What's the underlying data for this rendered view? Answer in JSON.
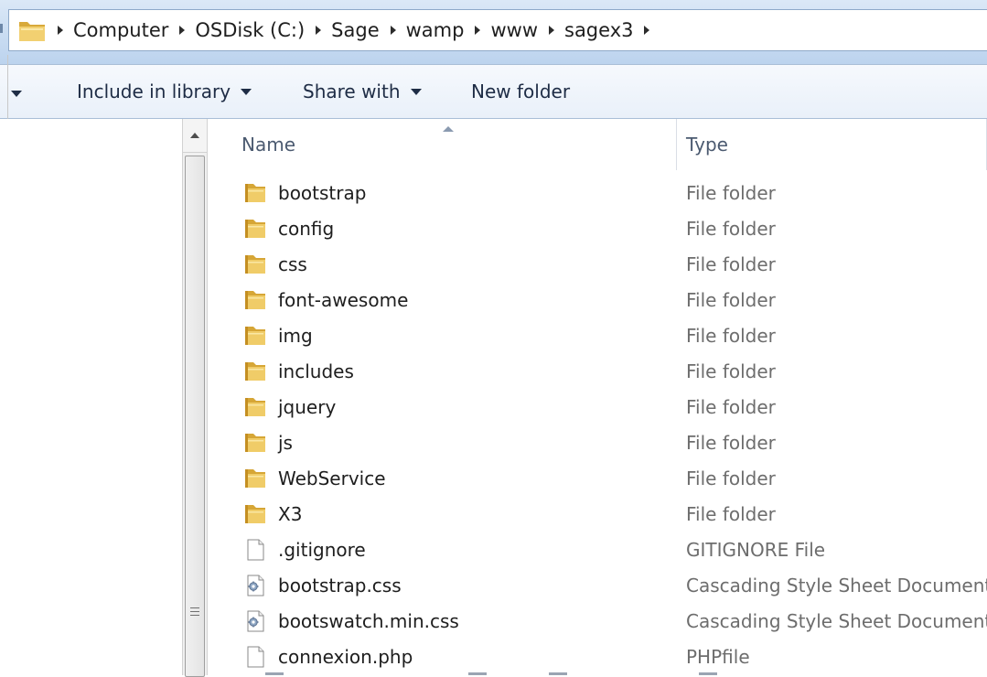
{
  "address_bar": {
    "breadcrumbs": [
      "Computer",
      "OSDisk (C:)",
      "Sage",
      "wamp",
      "www",
      "sagex3"
    ]
  },
  "command_bar": {
    "include_in_library": "Include in library",
    "share_with": "Share with",
    "new_folder": "New folder"
  },
  "columns": {
    "name": "Name",
    "type": "Type"
  },
  "files": [
    {
      "name": "bootstrap",
      "type": "File folder",
      "icon": "folder-icon"
    },
    {
      "name": "config",
      "type": "File folder",
      "icon": "folder-icon"
    },
    {
      "name": "css",
      "type": "File folder",
      "icon": "folder-icon"
    },
    {
      "name": "font-awesome",
      "type": "File folder",
      "icon": "folder-icon"
    },
    {
      "name": "img",
      "type": "File folder",
      "icon": "folder-icon"
    },
    {
      "name": "includes",
      "type": "File folder",
      "icon": "folder-icon"
    },
    {
      "name": "jquery",
      "type": "File folder",
      "icon": "folder-icon"
    },
    {
      "name": "js",
      "type": "File folder",
      "icon": "folder-icon"
    },
    {
      "name": "WebService",
      "type": "File folder",
      "icon": "folder-icon"
    },
    {
      "name": "X3",
      "type": "File folder",
      "icon": "folder-icon"
    },
    {
      "name": ".gitignore",
      "type": "GITIGNORE File",
      "icon": "blank-file-icon"
    },
    {
      "name": "bootstrap.css",
      "type": "Cascading Style Sheet Document",
      "icon": "css-file-icon"
    },
    {
      "name": "bootswatch.min.css",
      "type": "Cascading Style Sheet Document",
      "icon": "css-file-icon"
    },
    {
      "name": "connexion.php",
      "type": "PHPfile",
      "icon": "blank-file-icon"
    }
  ],
  "colors": {
    "folder": "#e8c35a",
    "header_bg": "#c9dcf2",
    "type_text": "#6d6d6d"
  }
}
